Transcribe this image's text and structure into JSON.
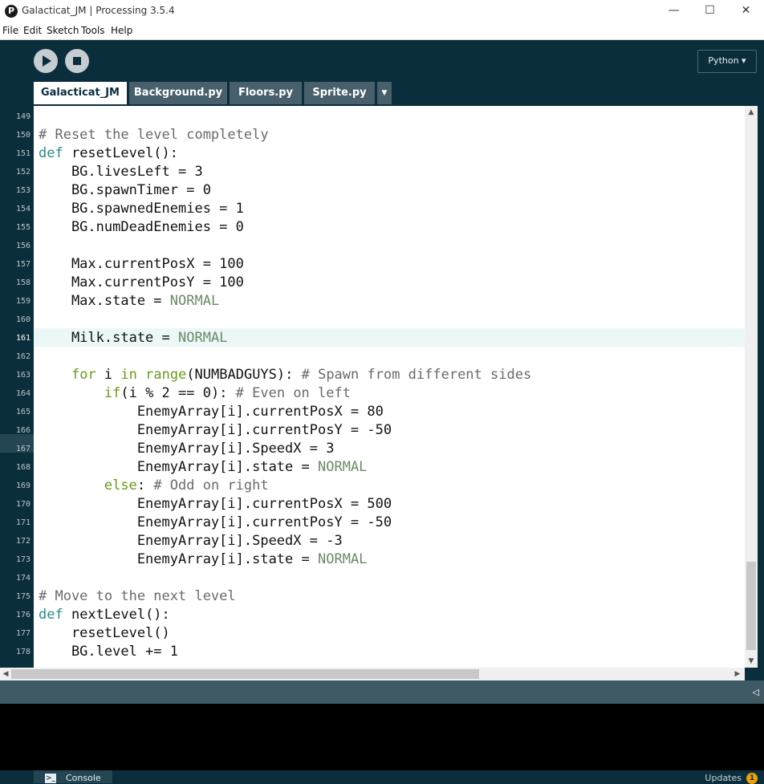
{
  "window": {
    "title": "Galacticat_JM | Processing 3.5.4",
    "app_icon_glyph": "P",
    "minimize": "—",
    "maximize": "☐",
    "close": "✕"
  },
  "menu": [
    "File",
    "Edit",
    "Sketch",
    "Tools",
    "Help"
  ],
  "toolbar": {
    "mode_label": "Python ▾"
  },
  "tabs": [
    {
      "label": "Galacticat_JM",
      "active": true
    },
    {
      "label": "Background.py",
      "active": false
    },
    {
      "label": "Floors.py",
      "active": false
    },
    {
      "label": "Sprite.py",
      "active": false
    }
  ],
  "tab_menu_glyph": "▼",
  "editor": {
    "line_numbers": [
      "149",
      "150",
      "151",
      "152",
      "153",
      "154",
      "155",
      "156",
      "157",
      "158",
      "159",
      "160",
      "161",
      "162",
      "163",
      "164",
      "165",
      "166",
      "167",
      "168",
      "169",
      "170",
      "171",
      "172",
      "173",
      "174",
      "175",
      "176",
      "177",
      "178"
    ],
    "active_line": "161",
    "lines": [
      [],
      [
        {
          "t": "# Reset the level completely",
          "c": "com"
        }
      ],
      [
        {
          "t": "def",
          "c": "kw"
        },
        {
          "t": " resetLevel():"
        }
      ],
      [
        {
          "t": "    BG.livesLeft = 3"
        }
      ],
      [
        {
          "t": "    BG.spawnTimer = 0"
        }
      ],
      [
        {
          "t": "    BG.spawnedEnemies = 1"
        }
      ],
      [
        {
          "t": "    BG.numDeadEnemies = 0"
        }
      ],
      [],
      [
        {
          "t": "    Max.currentPosX = 100"
        }
      ],
      [
        {
          "t": "    Max.currentPosY = 100"
        }
      ],
      [
        {
          "t": "    Max.state = "
        },
        {
          "t": "NORMAL",
          "c": "const"
        }
      ],
      [],
      [
        {
          "t": "    Milk.state = "
        },
        {
          "t": "NORMAL",
          "c": "const"
        }
      ],
      [],
      [
        {
          "t": "    "
        },
        {
          "t": "for",
          "c": "kw2"
        },
        {
          "t": " i "
        },
        {
          "t": "in",
          "c": "kw2"
        },
        {
          "t": " "
        },
        {
          "t": "range",
          "c": "kw2"
        },
        {
          "t": "(NUMBADGUYS): "
        },
        {
          "t": "# Spawn from different sides",
          "c": "com"
        }
      ],
      [
        {
          "t": "        "
        },
        {
          "t": "if",
          "c": "kw2"
        },
        {
          "t": "(i % 2 == 0): "
        },
        {
          "t": "# Even on left",
          "c": "com"
        }
      ],
      [
        {
          "t": "            EnemyArray[i].currentPosX = 80"
        }
      ],
      [
        {
          "t": "            EnemyArray[i].currentPosY = -50"
        }
      ],
      [
        {
          "t": "            EnemyArray[i].SpeedX = 3"
        }
      ],
      [
        {
          "t": "            EnemyArray[i].state = "
        },
        {
          "t": "NORMAL",
          "c": "const"
        }
      ],
      [
        {
          "t": "        "
        },
        {
          "t": "else",
          "c": "kw2"
        },
        {
          "t": ": "
        },
        {
          "t": "# Odd on right",
          "c": "com"
        }
      ],
      [
        {
          "t": "            EnemyArray[i].currentPosX = 500"
        }
      ],
      [
        {
          "t": "            EnemyArray[i].currentPosY = -50"
        }
      ],
      [
        {
          "t": "            EnemyArray[i].SpeedX = -3"
        }
      ],
      [
        {
          "t": "            EnemyArray[i].state = "
        },
        {
          "t": "NORMAL",
          "c": "const"
        }
      ],
      [],
      [
        {
          "t": "# Move to the next level",
          "c": "com"
        }
      ],
      [
        {
          "t": "def",
          "c": "kw"
        },
        {
          "t": " nextLevel():"
        }
      ],
      [
        {
          "t": "    resetLevel()"
        }
      ],
      [
        {
          "t": "    BG.level += 1"
        }
      ]
    ]
  },
  "scroll": {
    "up": "▲",
    "down": "▼",
    "left": "◀",
    "right": "▶"
  },
  "collapse_glyph": "◁",
  "footer": {
    "console_label": "Console",
    "console_icon_glyph": ">_",
    "updates_label": "Updates",
    "updates_count": "1"
  },
  "colors": {
    "background": "#0b2e3d",
    "tab_inactive": "#47606b",
    "comment": "#6a6a6a",
    "keyword_def": "#2c8a80",
    "keyword_flow": "#6a9a1a",
    "constant": "#6c8a66",
    "update_badge": "#f0a000"
  }
}
